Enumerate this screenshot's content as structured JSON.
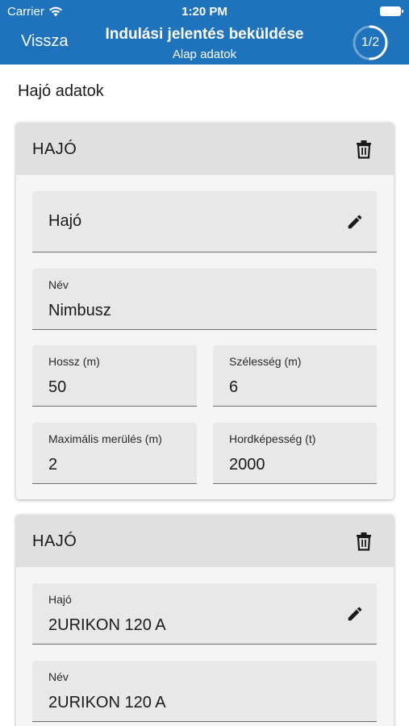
{
  "status": {
    "carrier": "Carrier",
    "time": "1:20 PM"
  },
  "nav": {
    "back_label": "Vissza",
    "title": "Indulási jelentés beküldése",
    "subtitle": "Alap adatok",
    "step": "1/2",
    "step_progress": 0.5
  },
  "section_title": "Hajó adatok",
  "colors": {
    "header": "#1f73bd",
    "card_head": "#e0e0e0",
    "field_bg": "#e8e8e8"
  },
  "cards": [
    {
      "title": "HAJÓ",
      "delete_icon": "trash-icon",
      "ship_field": {
        "value": "Hajó",
        "edit_icon": "pencil-icon"
      },
      "name": {
        "label": "Név",
        "value": "Nimbusz"
      },
      "length": {
        "label": "Hossz (m)",
        "value": "50"
      },
      "width": {
        "label": "Szélesség (m)",
        "value": "6"
      },
      "draft": {
        "label": "Maximális merülés (m)",
        "value": "2"
      },
      "capacity": {
        "label": "Hordképesség (t)",
        "value": "2000"
      }
    },
    {
      "title": "HAJÓ",
      "delete_icon": "trash-icon",
      "ship_field": {
        "label": "Hajó",
        "value": "2URIKON 120 A",
        "edit_icon": "pencil-icon"
      },
      "name": {
        "label": "Név",
        "value": "2URIKON 120 A"
      }
    }
  ]
}
